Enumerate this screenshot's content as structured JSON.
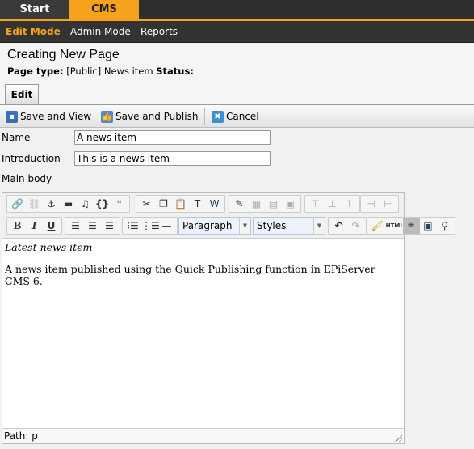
{
  "top_tabs": [
    {
      "label": "Start"
    },
    {
      "label": "CMS",
      "active": true
    }
  ],
  "modes": [
    {
      "label": "Edit Mode",
      "active": true
    },
    {
      "label": "Admin Mode"
    },
    {
      "label": "Reports"
    }
  ],
  "header": {
    "title": "Creating New Page",
    "page_type_label": "Page type:",
    "page_type_value": "[Public] News item",
    "status_label": "Status:",
    "status_value": ""
  },
  "edit_tab": "Edit",
  "toolbar": {
    "save_view": "Save and View",
    "save_publish": "Save and Publish",
    "cancel": "Cancel"
  },
  "form": {
    "name_label": "Name",
    "name_value": "A news item",
    "intro_label": "Introduction",
    "intro_value": "This is a news item",
    "body_label": "Main body"
  },
  "editor": {
    "format_select": "Paragraph",
    "styles_select": "Styles",
    "html_button": "HTML",
    "heading": "Latest news item",
    "paragraph": "A news item published using the Quick Publishing function in EPiServer CMS 6.",
    "path": "Path: p"
  },
  "colors": {
    "accent": "#f5a21c",
    "dark": "#2e2e2e"
  }
}
